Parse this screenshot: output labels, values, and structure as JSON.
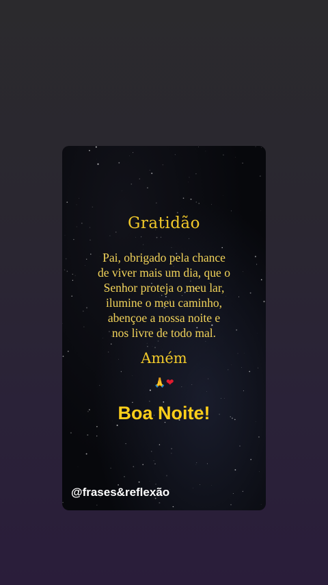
{
  "post": {
    "title": "Gratidão",
    "body_lines": [
      "Pai, obrigado pela chance",
      "de viver mais um dia, que o",
      "Senhor proteja o meu lar,",
      "ilumine o meu caminho,",
      "abençoe a nossa noite e",
      "nos livre de todo mal."
    ],
    "amen": "Amém",
    "greeting": "Boa Noite!",
    "handle": "@frases&reflexão",
    "emojis": [
      {
        "icon": "praying-hands-icon",
        "glyph": "🙏"
      },
      {
        "icon": "red-heart-icon",
        "glyph": "❤"
      }
    ]
  },
  "colors": {
    "title_gold": "#f1c92a",
    "greeting_yellow": "#ffcf1a",
    "card_background": "#07080c",
    "page_background_top": "#2b2a2d",
    "page_background_bottom": "#2a1d3a"
  }
}
